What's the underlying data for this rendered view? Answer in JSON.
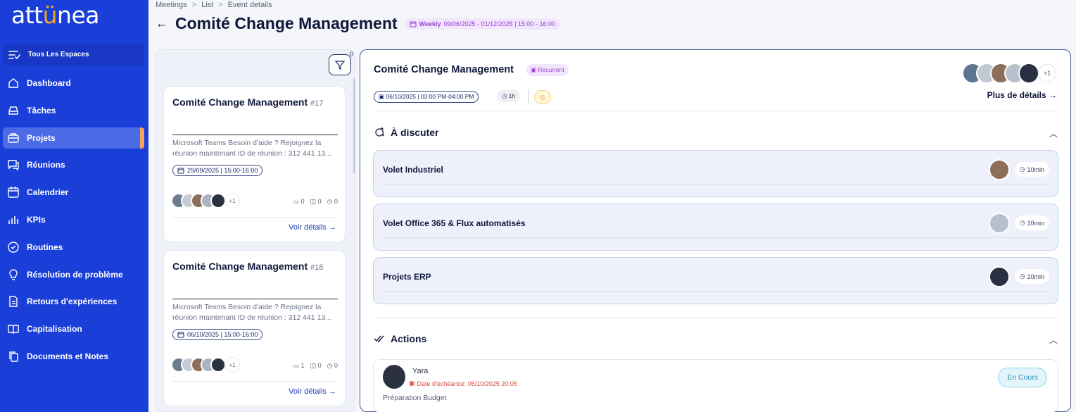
{
  "app": {
    "logo": "attunea"
  },
  "colors": {
    "sidebar": "#1a3fd9",
    "accent": "#f5a45a",
    "purple": "#9b3fd6",
    "status": "#2a8fb5"
  },
  "sidebar": {
    "space_label": "Tous Les Espaces",
    "items": [
      {
        "label": "Dashboard",
        "icon": "home-icon"
      },
      {
        "label": "Tâches",
        "icon": "tray-icon"
      },
      {
        "label": "Projets",
        "icon": "briefcase-icon",
        "active": true
      },
      {
        "label": "Réunions",
        "icon": "chat-icon"
      },
      {
        "label": "Calendrier",
        "icon": "calendar-icon"
      },
      {
        "label": "KPIs",
        "icon": "bar-chart-icon"
      },
      {
        "label": "Routines",
        "icon": "check-circle-icon"
      },
      {
        "label": "Résolution de problème",
        "icon": "lightbulb-icon"
      },
      {
        "label": "Retours d'expériences",
        "icon": "document-icon"
      },
      {
        "label": "Capitalisation",
        "icon": "book-icon"
      },
      {
        "label": "Documents et Notes",
        "icon": "copy-icon"
      }
    ]
  },
  "header": {
    "breadcrumb": [
      "Meetings",
      "List",
      "Event details"
    ],
    "title": "Comité Change Management",
    "schedule_freq": "Weekly",
    "schedule_text": "09/06/2025 - 01/12/2025 | 15:00 - 16:00"
  },
  "list": {
    "filter_count": "0",
    "cards": [
      {
        "title": "Comité Change Management",
        "number": "#17",
        "desc": "Microsoft Teams Besoin d'aide ? Rejoignez la réunion maintenant ID de réunion : 312 441 13...",
        "date": "29/09/2025 | 15:00-16:00",
        "plus": "+1",
        "c1": "0",
        "c2": "0",
        "c3": "0",
        "link": "Voir détails →"
      },
      {
        "title": "Comité Change Management",
        "number": "#18",
        "desc": "Microsoft Teams Besoin d'aide ? Rejoignez la réunion maintenant ID de réunion : 312 441 13...",
        "date": "06/10/2025 | 15:00-16:00",
        "plus": "+1",
        "c1": "1",
        "c2": "0",
        "c3": "0",
        "link": "Voir détails →"
      }
    ]
  },
  "detail": {
    "title": "Comité Change Management",
    "badge": "Recurrent",
    "date": "06/10/2025 | 03:00 PM-04:00 PM",
    "duration": "1h",
    "plus": "+1",
    "more": "Plus de détails →",
    "discuss_title": "À discuter",
    "topics": [
      {
        "name": "Volet Industriel",
        "duration": "10min"
      },
      {
        "name": "Volet Office 365 & Flux automatisés",
        "duration": "10min"
      },
      {
        "name": "Projets ERP",
        "duration": "10min"
      }
    ],
    "actions_title": "Actions",
    "action": {
      "name": "Yara",
      "due": "Date d'échéance: 06/10/2025 20:05",
      "desc": "Préparation Budget",
      "status": "En Cours"
    }
  }
}
